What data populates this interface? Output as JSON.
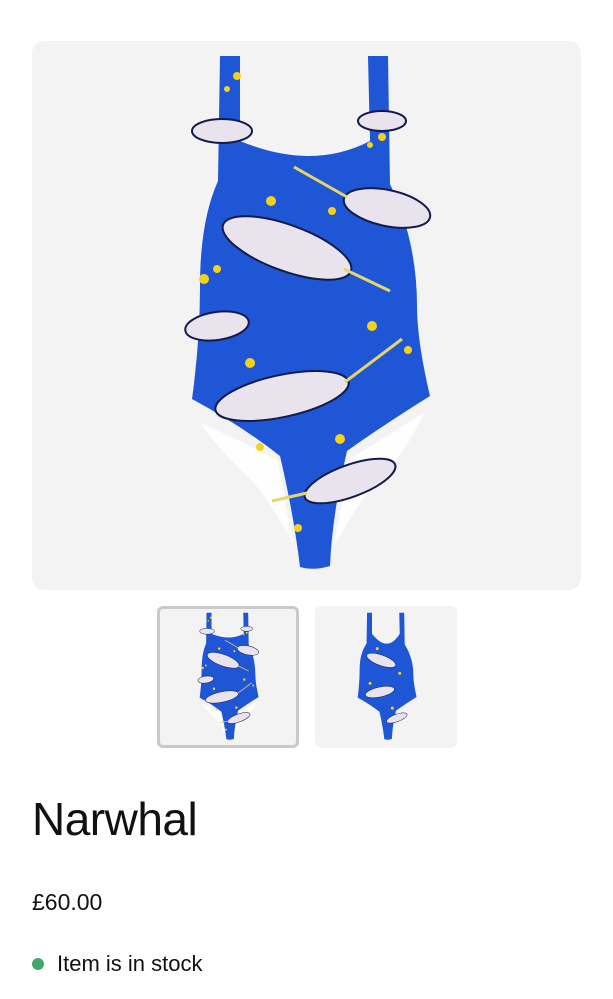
{
  "product": {
    "title": "Narwhal",
    "price": "£60.00",
    "stock_label": "Item is in stock",
    "stock_color": "#3fa86a",
    "swimsuit_color": "#1f56d6",
    "star_color": "#f5d21a"
  },
  "gallery": {
    "active_index": 0,
    "thumbnails": [
      {
        "view": "front",
        "active": true
      },
      {
        "view": "back",
        "active": false
      }
    ]
  }
}
